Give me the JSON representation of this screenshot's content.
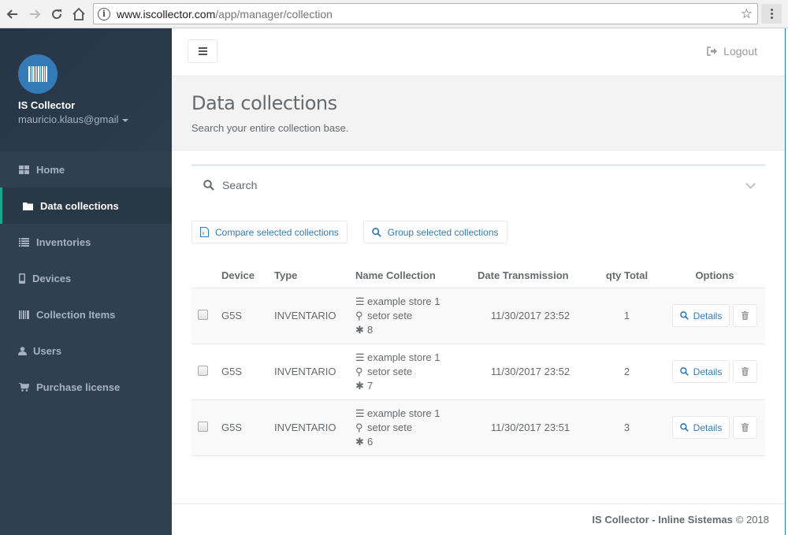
{
  "browser": {
    "url_host": "www.iscollector.com",
    "url_path": "/app/manager/collection",
    "icons": [
      "back-icon",
      "forward-icon",
      "reload-icon",
      "home-icon",
      "info-icon",
      "star-icon",
      "menu-icon"
    ]
  },
  "sidebar": {
    "app_name": "IS Collector",
    "user": "mauricio.klaus@gmail",
    "items": [
      {
        "label": "Home",
        "icon": "grid-icon",
        "active": false
      },
      {
        "label": "Data collections",
        "icon": "folder-icon",
        "active": true
      },
      {
        "label": "Inventories",
        "icon": "list-icon",
        "active": false
      },
      {
        "label": "Devices",
        "icon": "mobile-icon",
        "active": false
      },
      {
        "label": "Collection Items",
        "icon": "barcode-icon",
        "active": false
      },
      {
        "label": "Users",
        "icon": "user-icon",
        "active": false
      },
      {
        "label": "Purchase license",
        "icon": "cart-icon",
        "active": false
      }
    ],
    "accent": "#19aa8d"
  },
  "topbar": {
    "logout_label": "Logout"
  },
  "heading": {
    "title": "Data collections",
    "subtitle": "Search your entire collection base."
  },
  "search": {
    "label": "Search"
  },
  "actions": {
    "compare_label": "Compare selected collections",
    "group_label": "Group selected collections"
  },
  "table": {
    "headers": [
      "Device",
      "Type",
      "Name Collection",
      "Date Transmission",
      "qty Total",
      "Options"
    ],
    "details_label": "Details",
    "rows": [
      {
        "device": "G5S",
        "type": "INVENTARIO",
        "name": "example store 1",
        "location": "setor sete",
        "code": "8",
        "date": "11/30/2017 23:52",
        "qty": "1"
      },
      {
        "device": "G5S",
        "type": "INVENTARIO",
        "name": "example store 1",
        "location": "setor sete",
        "code": "7",
        "date": "11/30/2017 23:52",
        "qty": "2"
      },
      {
        "device": "G5S",
        "type": "INVENTARIO",
        "name": "example store 1",
        "location": "setor sete",
        "code": "6",
        "date": "11/30/2017 23:51",
        "qty": "3"
      }
    ]
  },
  "footer": {
    "brand": "IS Collector - Inline Sistemas",
    "copyright": "© 2018"
  },
  "colors": {
    "sidebar_bg": "#2f4050",
    "link": "#337ab7",
    "avatar": "#337ab7"
  }
}
